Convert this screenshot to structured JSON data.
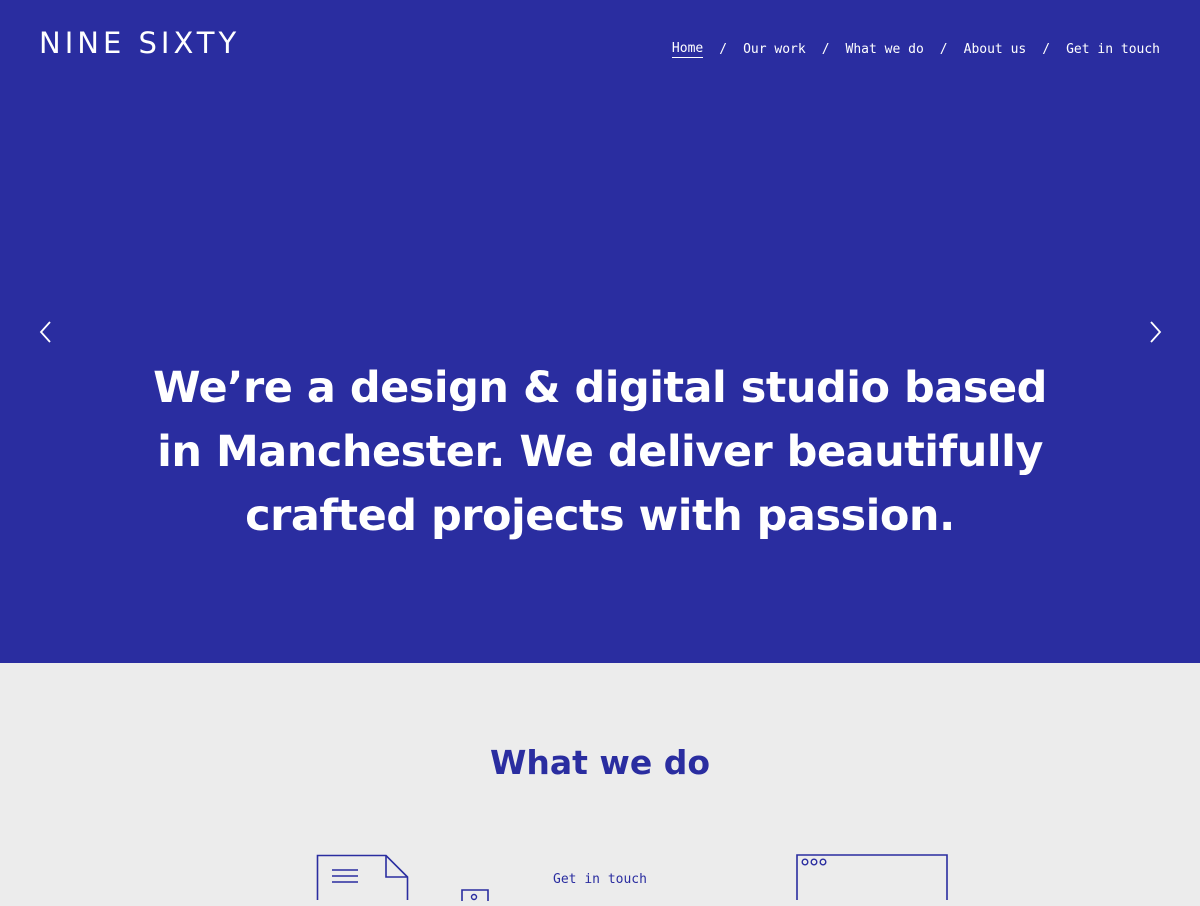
{
  "brand": {
    "logo_text": "NINE SIXTY"
  },
  "nav": {
    "items": [
      {
        "label": "Home",
        "active": true
      },
      {
        "label": "Our work"
      },
      {
        "label": "What we do"
      },
      {
        "label": "About us"
      },
      {
        "label": "Get in touch"
      }
    ],
    "separator": "/"
  },
  "hero": {
    "headline_lines": [
      "We’re a design & digital studio based",
      "in Manchester. We deliver beautifully",
      "crafted projects with passion."
    ],
    "prev_icon": "chevron-left-icon",
    "next_icon": "chevron-right-icon"
  },
  "what_we_do": {
    "title": "What we do",
    "link_label": "Get in touch",
    "icons": [
      "document-icon",
      "small-frame-icon",
      "browser-window-icon"
    ]
  },
  "colors": {
    "brand_blue": "#2a2da0",
    "section_bg": "#ececec",
    "text_on_brand": "#ffffff"
  }
}
